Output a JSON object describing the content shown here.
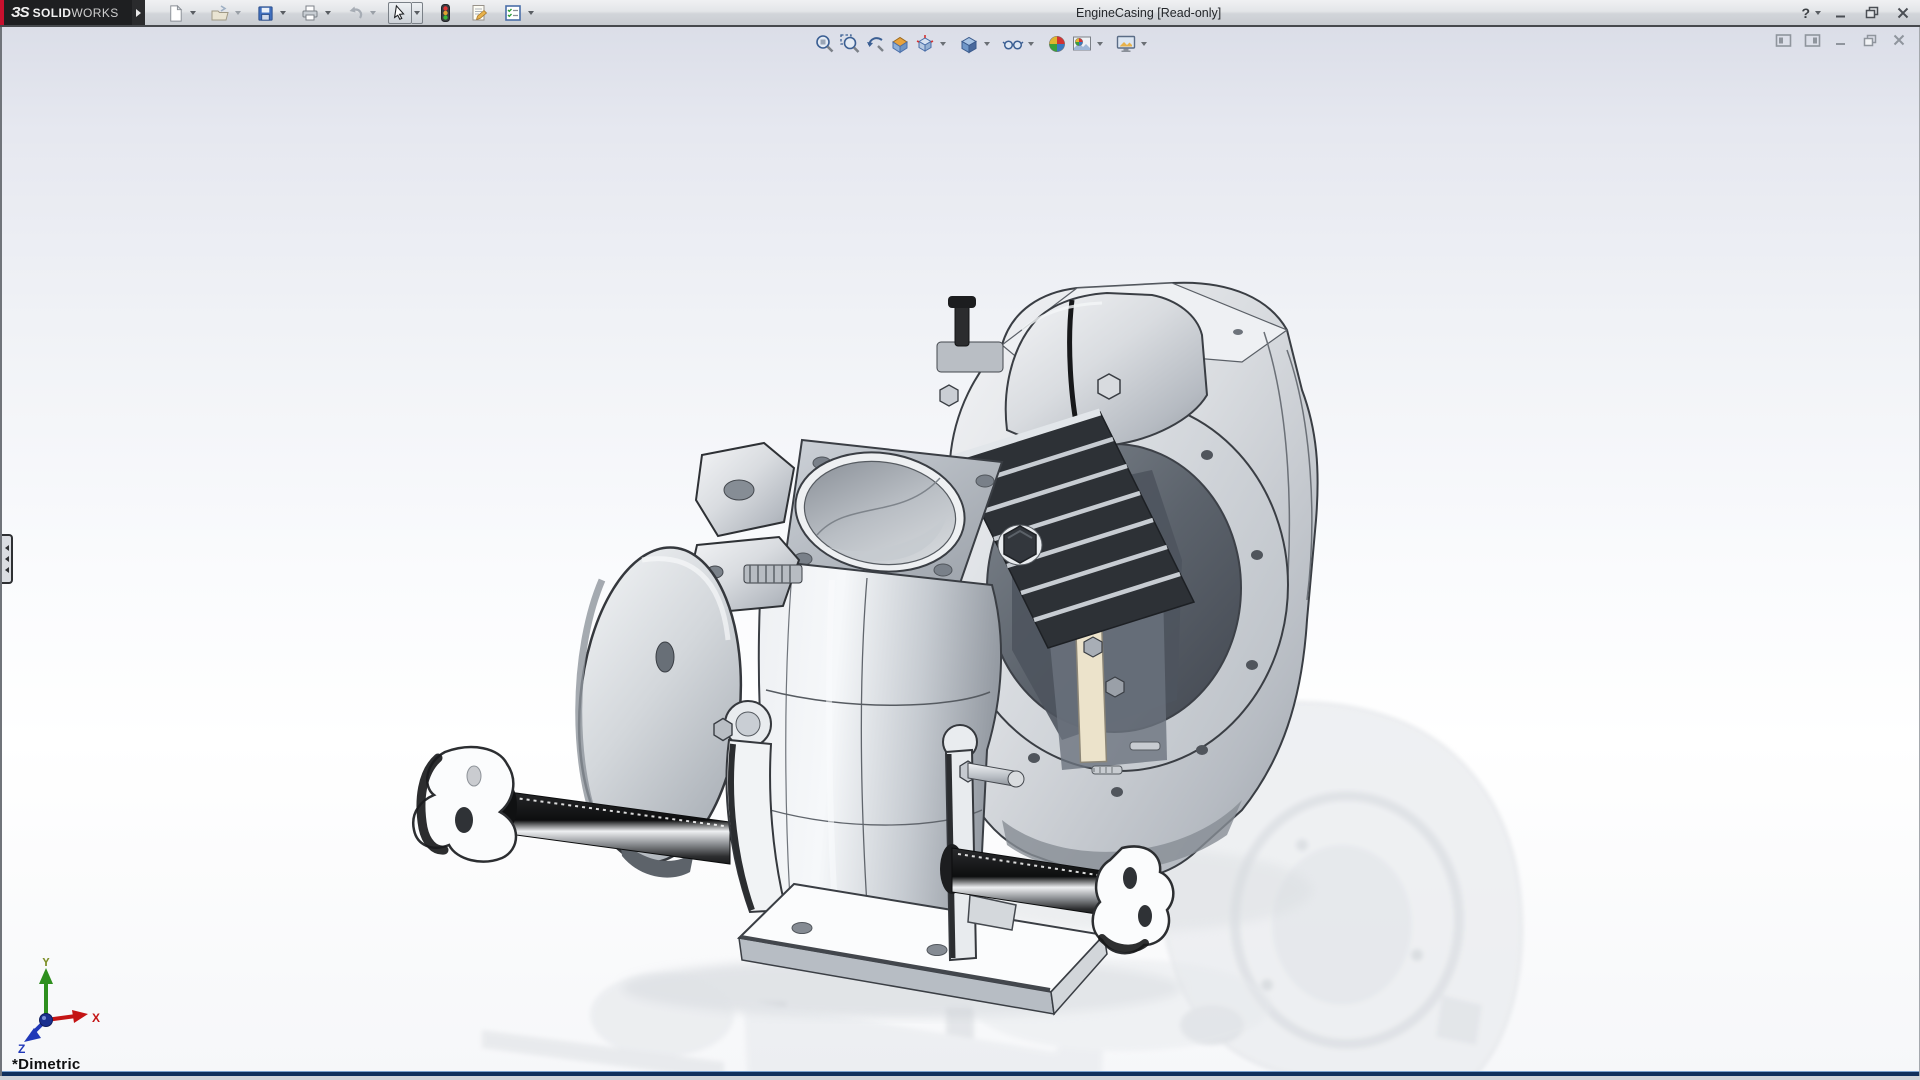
{
  "titlebar": {
    "brand": {
      "mark": "ЗS",
      "name_bold": "SOLID",
      "name_light": "WORKS"
    },
    "title": "EngineCasing [Read-only]",
    "help_glyph": "?"
  },
  "standard_toolbar": {
    "tools": [
      {
        "name": "new-document",
        "dropdown": true
      },
      {
        "name": "open",
        "dropdown": true
      },
      {
        "name": "save",
        "dropdown": true
      },
      {
        "name": "print",
        "dropdown": true
      },
      {
        "name": "undo",
        "dropdown": true,
        "disabled": true
      },
      {
        "name": "select",
        "dropdown": true,
        "active": true
      },
      {
        "name": "rebuild-stoplight",
        "dropdown": false
      },
      {
        "name": "file-properties",
        "dropdown": false
      },
      {
        "name": "options-checklist",
        "dropdown": true
      }
    ]
  },
  "heads_up_toolbar": {
    "tools": [
      {
        "name": "zoom-to-fit"
      },
      {
        "name": "zoom-to-area"
      },
      {
        "name": "previous-view"
      },
      {
        "name": "section-view"
      },
      {
        "name": "view-orientation",
        "dropdown": true
      },
      {
        "name": "display-style",
        "dropdown": true
      },
      {
        "name": "hide-show-items",
        "dropdown": true
      },
      {
        "name": "edit-appearance"
      },
      {
        "name": "apply-scene",
        "dropdown": true
      },
      {
        "name": "view-settings",
        "dropdown": true
      }
    ]
  },
  "window_controls": {
    "app": [
      "help",
      "minimize",
      "restore",
      "close"
    ],
    "document": [
      "pane-left",
      "pane-right",
      "minimize",
      "restore",
      "close"
    ]
  },
  "viewport": {
    "view_label": "*Dimetric",
    "model": "engine-casing-assembly-on-stand",
    "triad": {
      "x": "X",
      "y": "Y",
      "z": "Z"
    }
  },
  "colors": {
    "logo_bg": "#1e1f21",
    "logo_red": "#c8102e",
    "titlebar_bottom_border": "#46494d",
    "viewport_top": "#dbdee8",
    "viewport_bottom": "#f6f7f9",
    "frame_blue": "#10305c",
    "triad_x": "#c41414",
    "triad_y": "#2e8f1e",
    "triad_z": "#2038b8"
  }
}
